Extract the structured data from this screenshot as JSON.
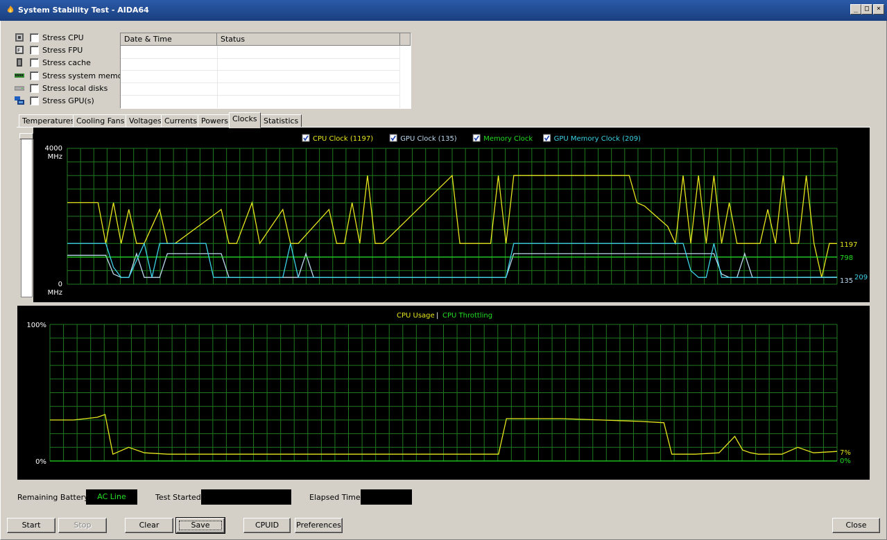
{
  "window": {
    "title": "System Stability Test - AIDA64",
    "buttons": {
      "minimize": "_",
      "maximize": "□",
      "close": "×"
    }
  },
  "stress_options": [
    {
      "label": "Stress CPU",
      "icon": "cpu-icon",
      "checked": false
    },
    {
      "label": "Stress FPU",
      "icon": "fpu-icon",
      "checked": false
    },
    {
      "label": "Stress cache",
      "icon": "cache-icon",
      "checked": false
    },
    {
      "label": "Stress system memory",
      "icon": "memory-icon",
      "checked": false
    },
    {
      "label": "Stress local disks",
      "icon": "disk-icon",
      "checked": false
    },
    {
      "label": "Stress GPU(s)",
      "icon": "gpu-icon",
      "checked": false
    }
  ],
  "log_table": {
    "columns": [
      "Date & Time",
      "Status"
    ],
    "rows": []
  },
  "tabs": [
    "Temperatures",
    "Cooling Fans",
    "Voltages",
    "Currents",
    "Powers",
    "Clocks",
    "Statistics"
  ],
  "active_tab": "Clocks",
  "chart_data": [
    {
      "type": "line",
      "legend": [
        {
          "label": "CPU Clock (1197)",
          "color": "#e6e61e",
          "checked": true
        },
        {
          "label": "GPU Clock (135)",
          "color": "#bcd9f0",
          "checked": true
        },
        {
          "label": "Memory Clock",
          "color": "#22dd22",
          "checked": true
        },
        {
          "label": "GPU Memory Clock (209)",
          "color": "#3cd2e6",
          "checked": true
        }
      ],
      "y_max_label": "4000",
      "y_min_label": "0",
      "y_unit": "MHz",
      "ylim": [
        0,
        4000
      ],
      "current_values": {
        "cpu": "1197",
        "memory": "798",
        "gpu": "135",
        "gpu_memory": "209"
      },
      "series": [
        {
          "name": "CPU Clock",
          "color": "#e6e61e",
          "x": [
            0,
            4,
            5,
            6,
            7,
            8,
            9,
            10,
            12,
            13,
            14,
            20,
            21,
            22,
            24,
            25,
            28,
            29,
            30,
            34,
            35,
            36,
            37,
            38,
            39,
            40,
            41,
            50,
            51,
            52,
            53,
            54,
            55,
            56,
            57,
            58,
            59,
            60,
            61,
            62,
            63,
            64,
            65,
            66,
            67,
            68,
            69,
            70,
            71,
            72,
            73,
            74,
            75,
            76,
            77,
            78,
            79,
            80,
            81,
            82,
            83,
            84,
            85,
            86,
            87,
            88,
            89,
            90,
            91,
            92,
            93,
            94,
            95,
            96,
            97,
            98,
            99,
            100
          ],
          "y": [
            2400,
            2400,
            1200,
            2400,
            1200,
            2200,
            1200,
            1200,
            2200,
            1200,
            1200,
            2200,
            1200,
            1200,
            2400,
            1200,
            2200,
            1200,
            1200,
            2200,
            1200,
            1200,
            2400,
            1200,
            3200,
            1200,
            1200,
            3200,
            1200,
            1200,
            1200,
            1200,
            1200,
            3200,
            1200,
            3200,
            3200,
            3200,
            3200,
            3200,
            3200,
            3200,
            3200,
            3200,
            3200,
            3200,
            3200,
            3200,
            3200,
            3200,
            3200,
            2400,
            2300,
            2100,
            1900,
            1700,
            1200,
            3200,
            1200,
            3200,
            1200,
            3200,
            1200,
            2400,
            1200,
            1200,
            1200,
            1200,
            2200,
            1200,
            3200,
            1200,
            1200,
            3200,
            1200,
            200,
            1200,
            1197
          ]
        },
        {
          "name": "GPU Clock",
          "color": "#bcd9f0",
          "x": [
            0,
            5,
            6,
            7,
            8,
            9,
            10,
            12,
            13,
            20,
            21,
            22,
            30,
            31,
            32,
            34,
            35,
            57,
            58,
            84,
            85,
            86,
            87,
            88,
            89,
            90,
            100
          ],
          "y": [
            850,
            850,
            300,
            200,
            200,
            900,
            200,
            200,
            900,
            900,
            200,
            200,
            200,
            900,
            200,
            200,
            200,
            200,
            900,
            900,
            300,
            200,
            200,
            900,
            200,
            200,
            200
          ]
        },
        {
          "name": "Memory Clock",
          "color": "#22dd22",
          "x": [
            0,
            100
          ],
          "y": [
            798,
            798
          ]
        },
        {
          "name": "GPU Memory Clock",
          "color": "#3cd2e6",
          "x": [
            0,
            5,
            6,
            7,
            8,
            10,
            11,
            12,
            13,
            18,
            19,
            20,
            28,
            29,
            30,
            57,
            58,
            80,
            81,
            82,
            83,
            84,
            85,
            86,
            87,
            88,
            89,
            90,
            100
          ],
          "y": [
            1200,
            1200,
            500,
            200,
            200,
            1200,
            200,
            1200,
            1200,
            1200,
            200,
            200,
            200,
            1200,
            200,
            200,
            1200,
            1200,
            400,
            200,
            200,
            1200,
            200,
            200,
            200,
            200,
            200,
            200,
            209
          ]
        }
      ]
    },
    {
      "type": "line",
      "legend": [
        {
          "label": "CPU Usage",
          "color": "#e6e61e"
        },
        {
          "label": "CPU Throttling",
          "color": "#22dd22"
        }
      ],
      "legend_separator": "|",
      "y_max_label": "100%",
      "y_min_label": "0%",
      "ylim": [
        0,
        100
      ],
      "current_values": {
        "usage": "7%",
        "throttling": "0%"
      },
      "series": [
        {
          "name": "CPU Usage",
          "color": "#e6e61e",
          "x": [
            0,
            3,
            6,
            7,
            8,
            10,
            12,
            15,
            20,
            25,
            30,
            35,
            40,
            45,
            50,
            55,
            57,
            58,
            60,
            65,
            70,
            75,
            78,
            79,
            80,
            82,
            85,
            87,
            88,
            89,
            90,
            93,
            95,
            97,
            100
          ],
          "y": [
            30,
            30,
            32,
            34,
            5,
            10,
            6,
            5,
            5,
            5,
            5,
            5,
            5,
            5,
            5,
            5,
            5,
            31,
            31,
            31,
            30,
            29,
            28,
            5,
            5,
            5,
            6,
            18,
            8,
            6,
            5,
            5,
            10,
            6,
            7
          ]
        },
        {
          "name": "CPU Throttling",
          "color": "#22dd22",
          "x": [
            0,
            100
          ],
          "y": [
            0,
            0
          ]
        }
      ]
    }
  ],
  "status": {
    "remaining_battery_label": "Remaining Battery:",
    "remaining_battery_value": "AC Line",
    "test_started_label": "Test Started:",
    "test_started_value": "",
    "elapsed_time_label": "Elapsed Time:",
    "elapsed_time_value": ""
  },
  "buttons": {
    "start": "Start",
    "stop": "Stop",
    "clear": "Clear",
    "save": "Save",
    "cpuid": "CPUID",
    "preferences": "Preferences",
    "close": "Close"
  }
}
